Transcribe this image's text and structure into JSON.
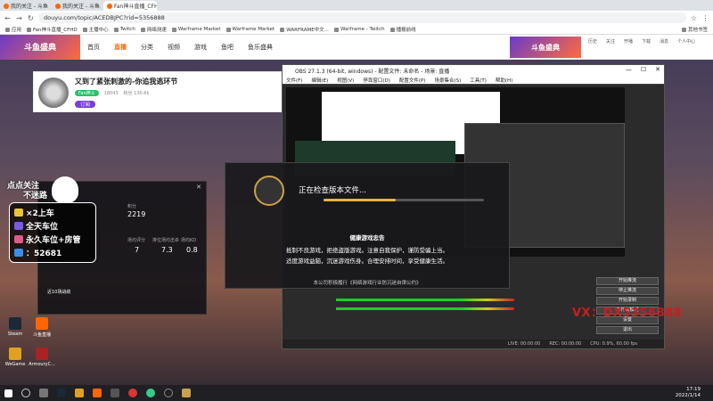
{
  "browser": {
    "tabs": [
      {
        "label": "我的关注 - 斗鱼",
        "active": false
      },
      {
        "label": "我的关注 - 斗鱼",
        "active": false
      },
      {
        "label": "Fan神斗直播_CFHD...",
        "active": true
      }
    ],
    "url": "douyu.com/topic/ACEDBJPC?rid=5356888",
    "bookmarks": [
      "应用",
      "Fan神斗直播_CFHD",
      "主播中心",
      "Twitch",
      "网络测速",
      "Warframe Market",
      "Warframe Market",
      "WARFRAME中文...",
      "Warframe - Twitch",
      "播报前线"
    ],
    "extra_bookmark": "其他书签"
  },
  "site": {
    "banner": "斗鱼盛典",
    "nav": [
      {
        "label": "首页",
        "active": false
      },
      {
        "label": "直播",
        "active": true
      },
      {
        "label": "分类",
        "active": false
      },
      {
        "label": "视频",
        "active": false
      },
      {
        "label": "游戏",
        "active": false
      },
      {
        "label": "鱼吧",
        "active": false
      },
      {
        "label": "鱼乐盛典",
        "active": false
      }
    ],
    "right_banner": "斗鱼盛典",
    "right_icons": [
      "历史",
      "关注",
      "开播",
      "下载",
      "消息",
      "个人中心"
    ]
  },
  "streamer": {
    "title": "又到了紧张刺激的-你追我逃环节",
    "tag": "Fan神斗",
    "meta": "18043",
    "follow": "订阅",
    "fans_label": "粉丝 130.6k"
  },
  "obs": {
    "title": "OBS 27.1.3 (64-bit, windows) - 配置文件: 未命名 - 场景: 直播",
    "menu": [
      "文件(F)",
      "编辑(E)",
      "视图(V)",
      "停靠窗口(D)",
      "配置文件(P)",
      "场景集合(S)",
      "工具(T)",
      "帮助(H)"
    ],
    "controls": [
      "开始推流",
      "停止推流",
      "开始录制",
      "工作室模式",
      "设置",
      "退出"
    ],
    "status": [
      "LIVE: 00:00:00",
      "REC: 00:00:00",
      "CPU: 0.9%, 60.00 fps"
    ]
  },
  "dialog": {
    "status": "正在检查版本文件...",
    "progress": 0.45,
    "notice_title": "健康游戏忠告",
    "notice_lines": [
      "抵制不良游戏，拒绝盗版游戏。注意自我保护，谨防受骗上当。",
      "适度游戏益脑，沉迷游戏伤身。合理安排时间，享受健康生活。"
    ],
    "footer": "本公司积极履行《网络游戏行业防沉迷自律公约》"
  },
  "game_panel": {
    "score_label": "积分",
    "score": "2219",
    "stats": [
      {
        "label": "场均评分",
        "value": "7"
      },
      {
        "label": "排位场均击杀",
        "value": "7.3"
      },
      {
        "label": "场均KD",
        "value": "0.8"
      }
    ],
    "bottom_label": "近10场战绩"
  },
  "overlay": {
    "title_line1": "点点关注",
    "title_line2": "不迷路",
    "items": [
      {
        "text": "×2上车",
        "icon_color": "#e8c43a"
      },
      {
        "text": "全天车位",
        "icon_color": "#7a5be0"
      },
      {
        "text": "永久车位+房管",
        "icon_color": "#e05b8a"
      },
      {
        "text": "：52681",
        "icon_color": "#3a8ee8"
      }
    ]
  },
  "watermark": "VX：DX5356888",
  "desktop": [
    {
      "label": "Steam",
      "color": "#1b2838"
    },
    {
      "label": "斗鱼直播",
      "color": "#f60"
    },
    {
      "label": "WeGame",
      "color": "#e0a020"
    },
    {
      "label": "ArmouryC...",
      "color": "#aa2222"
    }
  ],
  "taskbar": {
    "time": "17:19",
    "date": "2022/1/14"
  }
}
